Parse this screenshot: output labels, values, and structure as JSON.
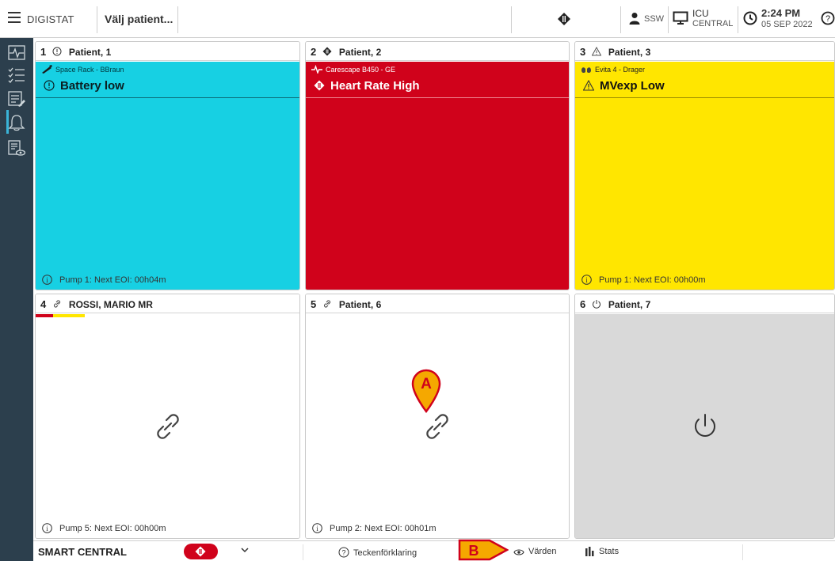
{
  "topbar": {
    "app_name": "DIGISTAT",
    "patient_selector": "Välj patient...",
    "user": "SSW",
    "location_line1": "ICU",
    "location_line2": "CENTRAL",
    "time": "2:24 PM",
    "date": "05 SEP 2022"
  },
  "sidebar": {
    "items": [
      {
        "icon": "monitor-waveform-icon"
      },
      {
        "icon": "checklist-icon"
      },
      {
        "icon": "notes-edit-icon"
      },
      {
        "icon": "bell-icon",
        "active": true
      },
      {
        "icon": "calendar-eye-icon"
      }
    ]
  },
  "tiles": [
    {
      "num": "1",
      "name": "Patient, 1",
      "head_icon": "info-circle-icon",
      "color": "#17d0e3",
      "device": "Space Rack - BBraun",
      "alarm": "Battery low",
      "footer": "Pump 1: Next EOI: 00h04m"
    },
    {
      "num": "2",
      "name": "Patient, 2",
      "head_icon": "alarm-diamond-icon",
      "color": "#d0021b",
      "device": "Carescape B450 - GE",
      "alarm": "Heart Rate High"
    },
    {
      "num": "3",
      "name": "Patient, 3",
      "head_icon": "warning-triangle-icon",
      "color": "#ffe600",
      "device": "Evita 4 - Drager",
      "alarm": "MVexp Low",
      "footer": "Pump 1: Next EOI: 00h00m"
    },
    {
      "num": "4",
      "name": "ROSSI, MARIO MR",
      "head_icon": "link-icon",
      "footer": "Pump 5: Next EOI: 00h00m"
    },
    {
      "num": "5",
      "name": "Patient, 6",
      "head_icon": "link-icon",
      "footer": "Pump 2: Next EOI: 00h01m"
    },
    {
      "num": "6",
      "name": "Patient, 7",
      "head_icon": "power-icon",
      "color": "#d9d9d9"
    }
  ],
  "bottombar": {
    "title": "SMART CENTRAL",
    "legend": "Teckenförklaring",
    "values": "Värden",
    "stats": "Stats"
  },
  "markers": {
    "a": "A",
    "b": "B"
  },
  "colors": {
    "accent_marker": "#f5a800",
    "sidebar": "#2c3f4d",
    "alarm_red": "#d0021b"
  }
}
